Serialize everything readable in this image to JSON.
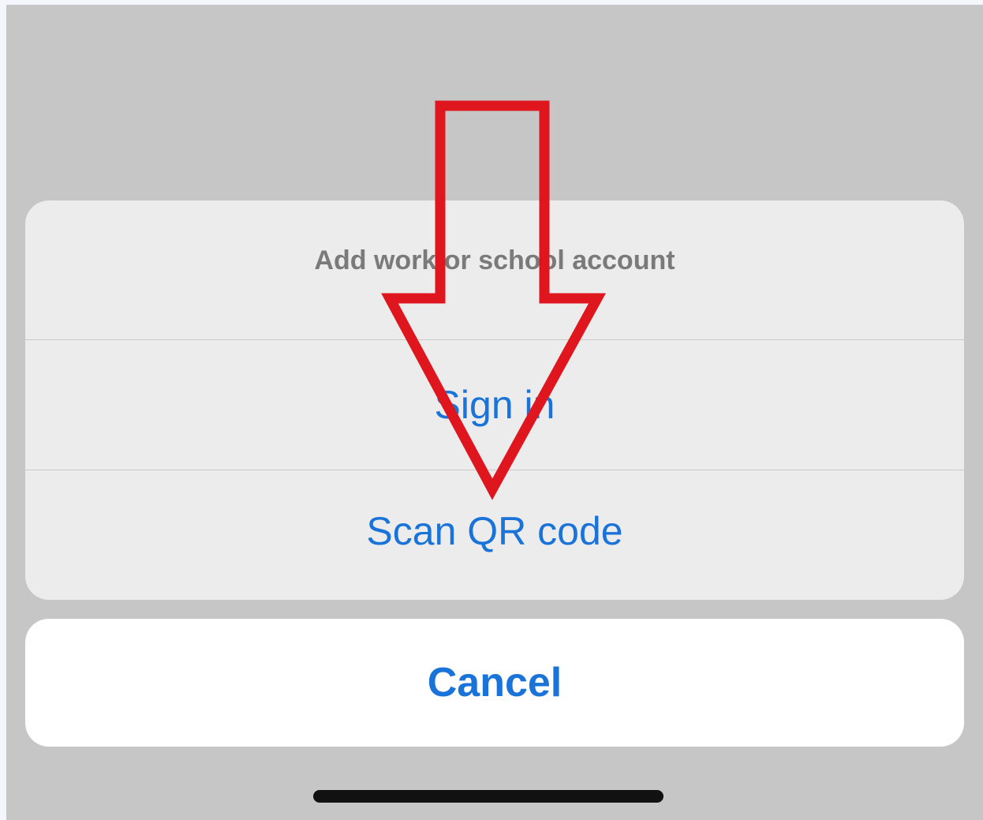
{
  "action_sheet": {
    "title": "Add work or school account",
    "actions": [
      {
        "label": "Sign in"
      },
      {
        "label": "Scan QR code"
      }
    ],
    "cancel_label": "Cancel"
  },
  "annotation": {
    "arrow_color": "#e0161e",
    "arrow_direction": "down"
  },
  "colors": {
    "action_blue": "#1a73d9",
    "title_gray": "#7a7a7a",
    "dim_background": "#c6c6c6"
  }
}
